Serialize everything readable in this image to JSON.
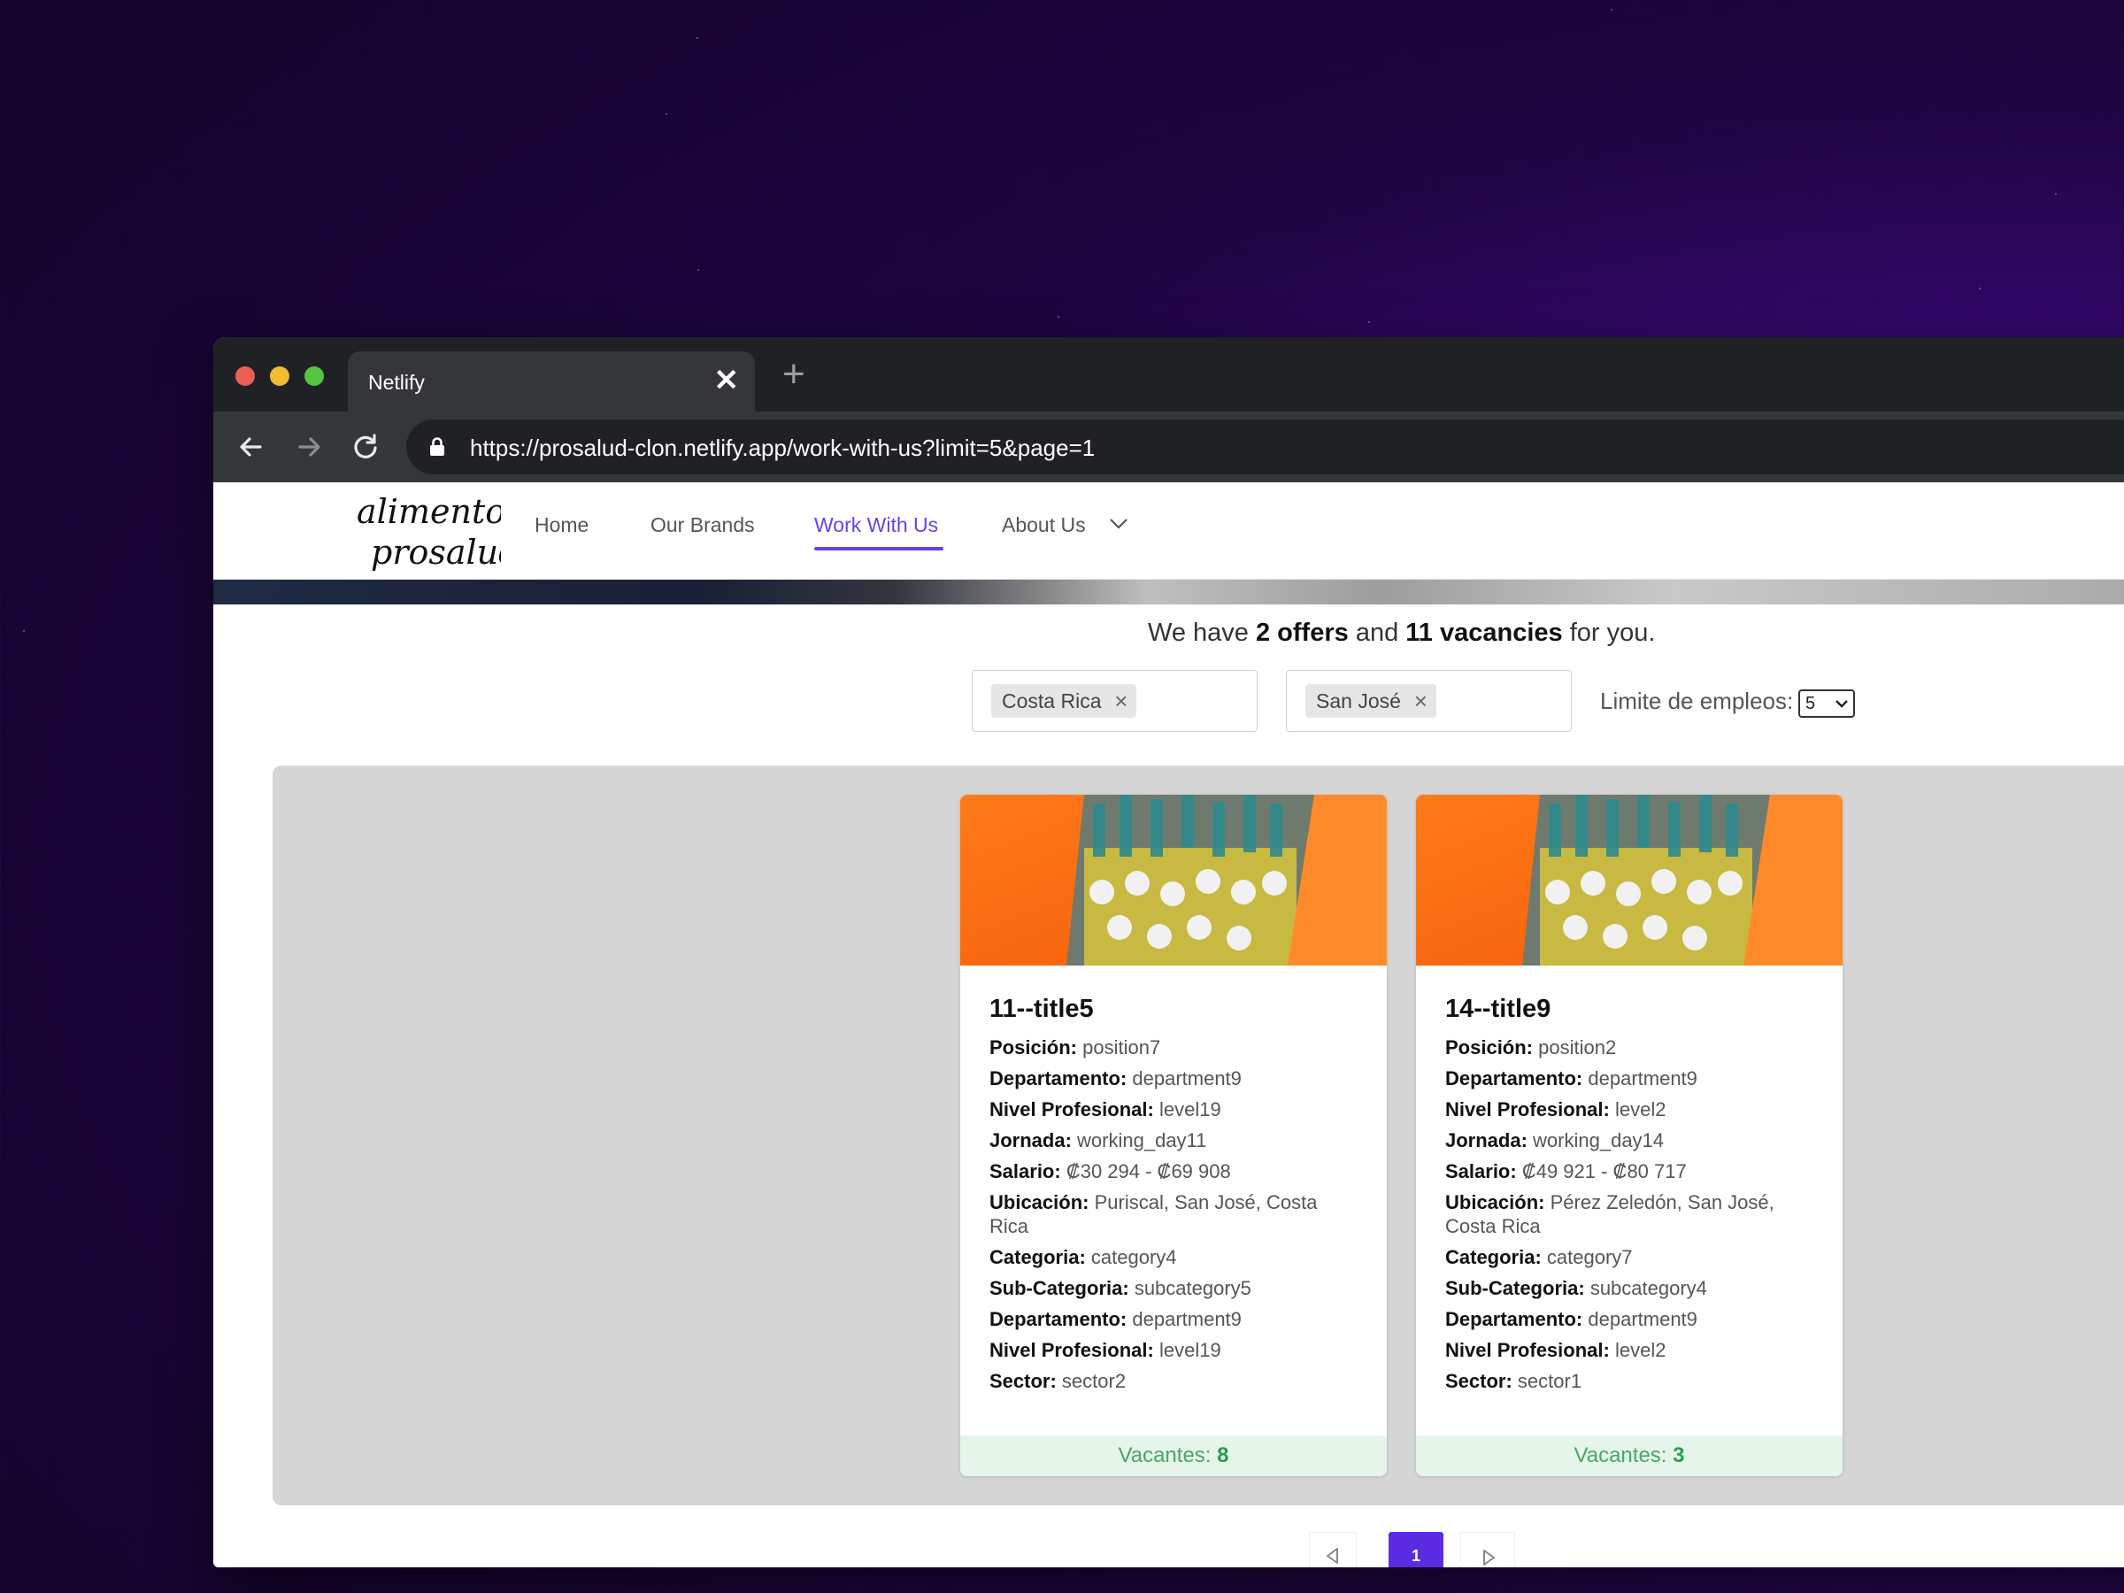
{
  "browser": {
    "tab_title": "Netlify",
    "tab_close": "✕",
    "new_tab": "+",
    "url": "https://prosalud-clon.netlify.app/work-with-us?limit=5&page=1"
  },
  "site": {
    "logo_text": [
      "alimentos",
      "prosalud"
    ],
    "nav": {
      "home": "Home",
      "brands": "Our Brands",
      "work": "Work With Us",
      "about": "About Us"
    },
    "accent_color": "#6a43e0"
  },
  "summary": {
    "prefix": "We have",
    "offers": "2 offers",
    "middle": "and",
    "vacancies": "11 vacancies",
    "suffix": "for you."
  },
  "filters": {
    "country_chip": "Costa Rica",
    "city_chip": "San José",
    "limit_label": "Limite de empleos:",
    "limit_value": "5"
  },
  "cards": [
    {
      "title": "11--title5",
      "fields": [
        {
          "label": "Posición:",
          "value": "position7"
        },
        {
          "label": "Departamento:",
          "value": "department9"
        },
        {
          "label": "Nivel Profesional:",
          "value": "level19"
        },
        {
          "label": "Jornada:",
          "value": "working_day11"
        },
        {
          "label": "Salario:",
          "value": "₡30 294 - ₡69 908"
        },
        {
          "label": "Ubicación:",
          "value": "Puriscal, San José, Costa Rica"
        },
        {
          "label": "Categoria:",
          "value": "category4"
        },
        {
          "label": "Sub-Categoria:",
          "value": "subcategory5"
        },
        {
          "label": "Departamento:",
          "value": "department9"
        },
        {
          "label": "Nivel Profesional:",
          "value": "level19"
        },
        {
          "label": "Sector:",
          "value": "sector2"
        }
      ],
      "vacancies_label": "Vacantes:",
      "vacancies": "8"
    },
    {
      "title": "14--title9",
      "fields": [
        {
          "label": "Posición:",
          "value": "position2"
        },
        {
          "label": "Departamento:",
          "value": "department9"
        },
        {
          "label": "Nivel Profesional:",
          "value": "level2"
        },
        {
          "label": "Jornada:",
          "value": "working_day14"
        },
        {
          "label": "Salario:",
          "value": "₡49 921 - ₡80 717"
        },
        {
          "label": "Ubicación:",
          "value": "Pérez Zeledón, San José, Costa Rica"
        },
        {
          "label": "Categoria:",
          "value": "category7"
        },
        {
          "label": "Sub-Categoria:",
          "value": "subcategory4"
        },
        {
          "label": "Departamento:",
          "value": "department9"
        },
        {
          "label": "Nivel Profesional:",
          "value": "level2"
        },
        {
          "label": "Sector:",
          "value": "sector1"
        }
      ],
      "vacancies_label": "Vacantes:",
      "vacancies": "3"
    }
  ],
  "pagination": {
    "current_page": "1",
    "prev_icon": "triangle-left-icon",
    "next_icon": "triangle-right-icon"
  }
}
